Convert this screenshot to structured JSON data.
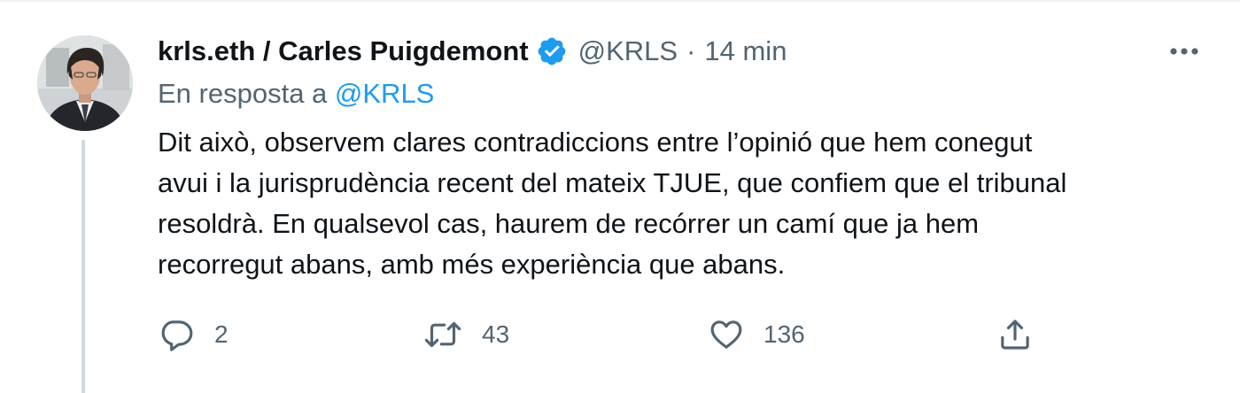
{
  "tweet": {
    "display_name": "krls.eth / Carles Puigdemont",
    "handle": "@KRLS",
    "separator": "·",
    "time": "14 min",
    "reply_prefix": "En resposta a ",
    "reply_mention": "@KRLS",
    "text_lines": [
      "Dit això, observem clares contradiccions entre l’opinió que hem conegut",
      "avui i la jurisprudència recent del mateix TJUE, que confiem que el tribunal",
      "resoldrà. En qualsevol cas, haurem de recórrer un camí que ja hem",
      "recorregut abans, amb més experiència que abans."
    ]
  },
  "actions": {
    "reply": {
      "icon": "reply-icon",
      "count": "2"
    },
    "retweet": {
      "icon": "retweet-icon",
      "count": "43"
    },
    "like": {
      "icon": "heart-icon",
      "count": "136"
    },
    "share": {
      "icon": "share-icon"
    }
  },
  "icons": {
    "verified": "verified-badge-icon",
    "more": "more-icon"
  },
  "colors": {
    "accent": "#1d9bf0",
    "secondary_text": "#536471",
    "primary_text": "#0f1419",
    "thread_line": "#cfd9de"
  }
}
